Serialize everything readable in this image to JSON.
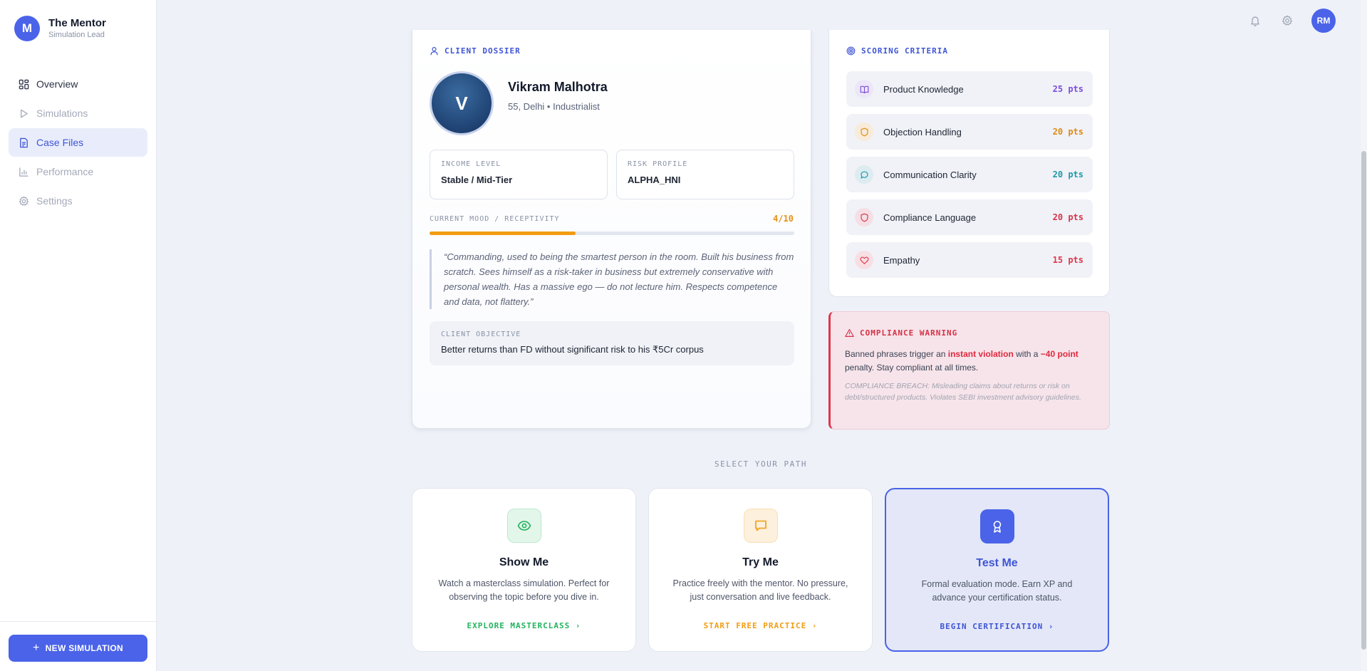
{
  "brand": {
    "initial": "M",
    "name": "The Mentor",
    "role": "Simulation Lead"
  },
  "nav": {
    "items": [
      {
        "label": "Overview",
        "icon": "grid-icon"
      },
      {
        "label": "Simulations",
        "icon": "play-icon"
      },
      {
        "label": "Case Files",
        "icon": "file-icon",
        "active": true
      },
      {
        "label": "Performance",
        "icon": "bar-chart-icon"
      },
      {
        "label": "Settings",
        "icon": "gear-icon"
      }
    ]
  },
  "new_sim": {
    "label": "NEW SIMULATION"
  },
  "header": {
    "avatar_initials": "RM"
  },
  "dossier": {
    "section_label": "CLIENT DOSSIER",
    "avatar_initial": "V",
    "name": "Vikram Malhotra",
    "meta": "55, Delhi • Industrialist",
    "income": {
      "label": "INCOME LEVEL",
      "value": "Stable / Mid-Tier"
    },
    "risk": {
      "label": "RISK PROFILE",
      "value": "ALPHA_HNI"
    },
    "mood": {
      "label": "CURRENT MOOD / RECEPTIVITY",
      "value": "4/10",
      "fraction": 0.4
    },
    "quote": "“Commanding, used to being the smartest person in the room. Built his business from scratch. Sees himself as a risk-taker in business but extremely conservative with personal wealth. Has a massive ego — do not lecture him. Respects competence and data, not flattery.”",
    "objective": {
      "label": "CLIENT OBJECTIVE",
      "value": "Better returns than FD without significant risk to his ₹5Cr corpus"
    }
  },
  "scoring": {
    "section_label": "SCORING CRITERIA",
    "criteria": [
      {
        "name": "Product Knowledge",
        "points": "25 pts",
        "icon": "book-icon",
        "color": "#7c4ddb",
        "bg": "#ece6f8"
      },
      {
        "name": "Objection Handling",
        "points": "20 pts",
        "icon": "shield-icon",
        "color": "#e08a14",
        "bg": "#f8ebd9"
      },
      {
        "name": "Communication Clarity",
        "points": "20 pts",
        "icon": "chat-icon",
        "color": "#1d9aa8",
        "bg": "#dcecf0"
      },
      {
        "name": "Compliance Language",
        "points": "20 pts",
        "icon": "shield-icon",
        "color": "#d9334a",
        "bg": "#f6dfe4"
      },
      {
        "name": "Empathy",
        "points": "15 pts",
        "icon": "heart-icon",
        "color": "#e0364b",
        "bg": "#f8dfe3"
      }
    ]
  },
  "warning": {
    "section_label": "COMPLIANCE WARNING",
    "text_1": "Banned phrases trigger an ",
    "highlight_1": "instant violation",
    "text_2": " with a ",
    "highlight_2": "−40 point",
    "text_3": " penalty. Stay compliant at all times.",
    "note": "COMPLIANCE BREACH: Misleading claims about returns or risk on debt/structured products. Violates SEBI investment advisory guidelines."
  },
  "paths": {
    "heading": "SELECT YOUR PATH",
    "cards": [
      {
        "title": "Show Me",
        "desc": "Watch a masterclass simulation. Perfect for observing the topic before you dive in.",
        "cta": "EXPLORE MASTERCLASS",
        "icon": "eye-icon",
        "color": "#22b35e",
        "bg": "#e3f6ea"
      },
      {
        "title": "Try Me",
        "desc": "Practice freely with the mentor. No pressure, just conversation and live feedback.",
        "cta": "START FREE PRACTICE",
        "icon": "chat-icon",
        "color": "#f29c11",
        "bg": "#fdf0dc"
      },
      {
        "title": "Test Me",
        "desc": "Formal evaluation mode. Earn XP and advance your certification status.",
        "cta": "BEGIN CERTIFICATION",
        "icon": "award-icon",
        "color": "#3f55d6",
        "bg": "#4a63e8",
        "selected": true
      }
    ]
  }
}
